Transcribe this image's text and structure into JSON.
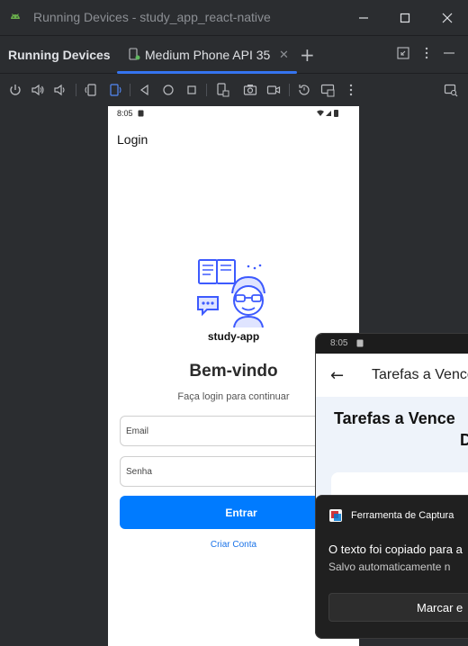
{
  "window": {
    "title": "Running Devices - study_app_react-native",
    "controls": [
      "minimize",
      "maximize",
      "close"
    ]
  },
  "tabbar": {
    "panel_title": "Running Devices",
    "active_tab": "Medium Phone API 35",
    "tab_close": "✕",
    "add_tab": "+"
  },
  "toolbar": {
    "icons": [
      "power-icon",
      "volume-up-icon",
      "volume-down-icon",
      "rotate-left-icon",
      "rotate-right-icon",
      "back-icon",
      "home-icon",
      "overview-icon",
      "device-state-icon",
      "camera-icon",
      "screen-record-icon",
      "reset-icon",
      "mirror-icon",
      "more-icon",
      "inspector-icon"
    ]
  },
  "device": {
    "status_time": "8:05",
    "header_title": "Login",
    "logo_text": "study-app",
    "welcome": "Bem-vindo",
    "subtitle": "Faça login para continuar",
    "email_placeholder": "Email",
    "password_placeholder": "Senha",
    "enter_button": "Entrar",
    "create_account_link": "Criar Conta"
  },
  "preview": {
    "status_time": "8:05",
    "app_title": "Tarefas a Vence",
    "heading_line1": "Tarefas a Vence",
    "heading_line2": "D"
  },
  "toast": {
    "app_name": "Ferramenta de Captura",
    "message": "O texto foi copiado para a",
    "sub_message": "Salvo automaticamente n",
    "action_button": "Marcar e"
  },
  "colors": {
    "ide_bg": "#2b2d30",
    "accent": "#3574f0",
    "primary_button": "#007bff",
    "logo_blue": "#3d5afe",
    "toast_bg": "#202020"
  }
}
